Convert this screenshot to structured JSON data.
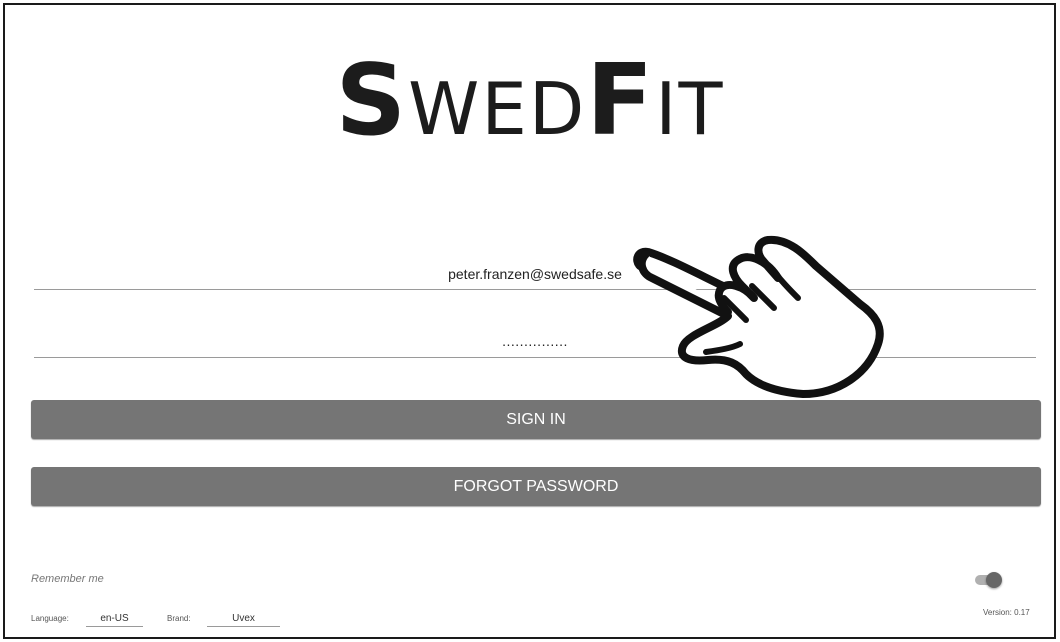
{
  "logo": {
    "s": "S",
    "wed": "WED",
    "f": "F",
    "it": "IT"
  },
  "login": {
    "email_value": "peter.franzen@swedsafe.se",
    "password_value": "...............",
    "sign_in_label": "SIGN IN",
    "forgot_label": "FORGOT PASSWORD"
  },
  "settings": {
    "remember_label": "Remember me",
    "remember_on": true,
    "language_label": "Language:",
    "language_value": "en-US",
    "brand_label": "Brand:",
    "brand_value": "Uvex",
    "version_text": "Version:  0.17"
  },
  "icons": {
    "pointer": "pointing-hand-icon"
  }
}
